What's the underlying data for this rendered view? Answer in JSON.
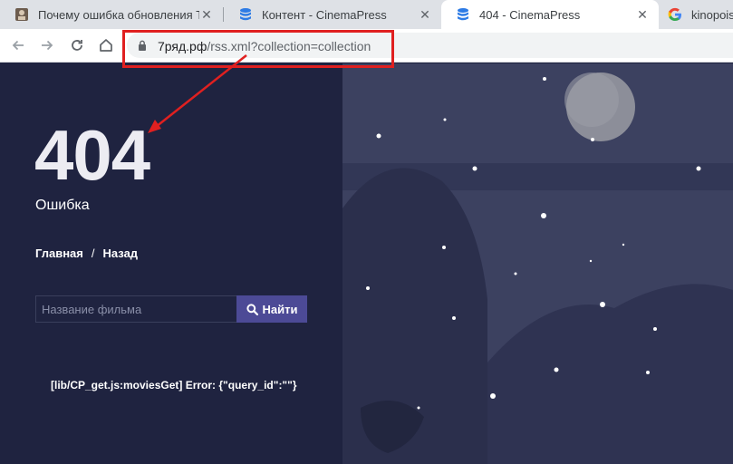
{
  "browser": {
    "tabs": [
      {
        "title": "Почему ошибка обновления Ту",
        "active": false
      },
      {
        "title": "Контент - CinemaPress",
        "active": false
      },
      {
        "title": "404 - CinemaPress",
        "active": true
      },
      {
        "title": "kinopoisk",
        "active": false
      }
    ],
    "url_host": "7ряд.рф",
    "url_path": "/rss.xml?collection=collection"
  },
  "page": {
    "code": "404",
    "subtitle": "Ошибка",
    "breadcrumb": {
      "home": "Главная",
      "separator": "/",
      "back": "Назад"
    },
    "search": {
      "placeholder": "Название фильма",
      "button_label": "Найти"
    },
    "error_message": "[lib/CP_get.js:moviesGet] Error: {\"query_id\":\"\"}"
  },
  "colors": {
    "page_bg": "#1f2340",
    "search_button": "#4c4a96",
    "annotation": "#e02020"
  },
  "icons": [
    "app-favicon",
    "database-icon",
    "google-icon",
    "back-arrow-icon",
    "forward-arrow-icon",
    "reload-icon",
    "home-icon",
    "lock-icon",
    "search-icon"
  ]
}
